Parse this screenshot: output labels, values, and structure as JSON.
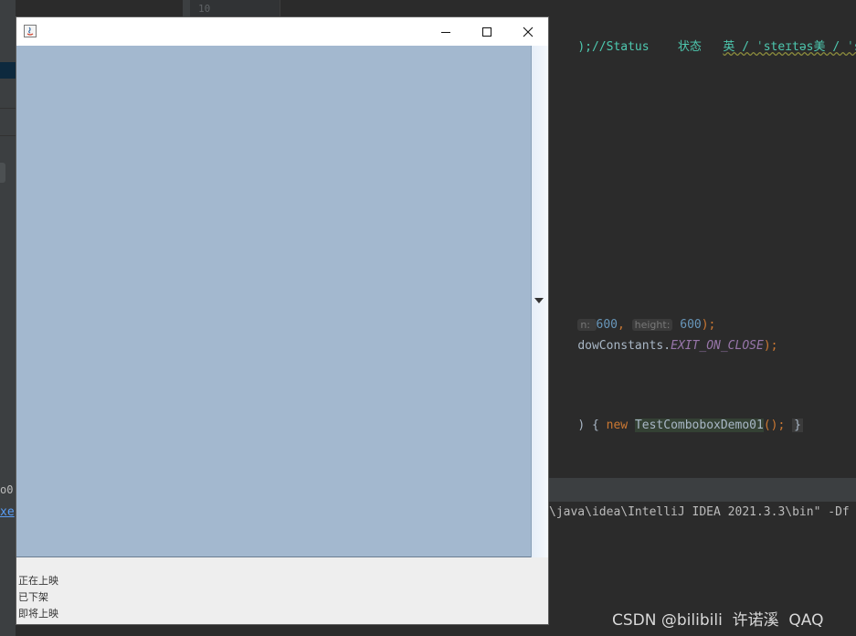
{
  "ide": {
    "line_number": "10",
    "code_status": ");//Status",
    "code_status_zh": "状态",
    "code_phonetic": "英 / ˈsteɪtəs美 / ˈst",
    "code_set_size_prefix": "n: ",
    "code_set_size_width": "600",
    "code_set_size_hint": "height:",
    "code_set_size_height": "600",
    "code_set_size_suffix": ");",
    "code_default_close": "dowConstants.",
    "code_exit_const": "EXIT_ON_CLOSE",
    "code_default_close_suffix": ");",
    "code_main_prefix": ") { ",
    "code_new_kw": "new",
    "code_new_class": "TestComboboxDemo01",
    "code_main_suffix": "();",
    "code_close_brace": "}",
    "left_tab_label": "o0",
    "left_exe_label": "xe",
    "terminal_path": "\\java\\idea\\IntelliJ IDEA 2021.3.3\\bin\" -Df"
  },
  "window": {
    "combo_items": [
      "正在上映",
      "已下架",
      "即将上映"
    ]
  },
  "watermark": "CSDN @bilibili  许诺溪  QAQ",
  "colors": {
    "ide_bg": "#2b2b2b",
    "popup_bg": "#a3b8cf",
    "window_bg": "#eeeeee"
  }
}
